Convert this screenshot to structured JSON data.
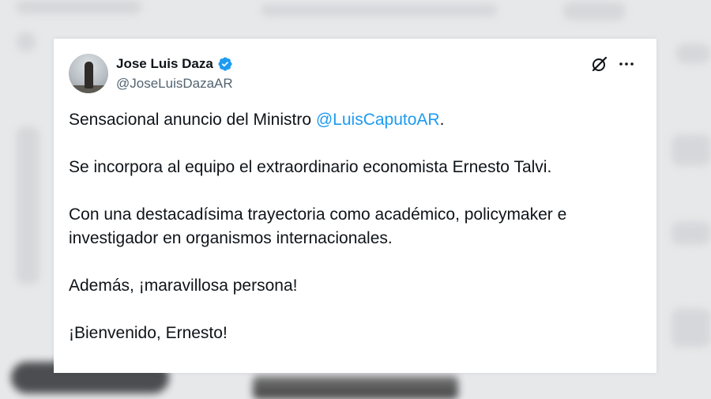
{
  "tweet": {
    "author": {
      "display_name": "Jose Luis Daza",
      "handle": "@JoseLuisDazaAR",
      "verified": true
    },
    "paragraphs": [
      {
        "before": "Sensacional anuncio del Ministro ",
        "mention": "@LuisCaputoAR",
        "after": "."
      },
      {
        "text": "Se incorpora al equipo el extraordinario economista Ernesto Talvi."
      },
      {
        "text": "Con una destacadísima trayectoria como académico, policymaker e investigador en organismos internacionales."
      },
      {
        "text": "Además, ¡maravillosa persona!"
      },
      {
        "text": "¡Bienvenido, Ernesto!"
      }
    ]
  },
  "icons": {
    "verified": "verified-badge-icon",
    "grok": "grok-icon",
    "more": "more-options-icon"
  },
  "colors": {
    "mention": "#1d9bf0",
    "verified": "#1d9bf0",
    "text": "#0f1419",
    "secondary": "#536471",
    "background": "#e7e8ea"
  }
}
